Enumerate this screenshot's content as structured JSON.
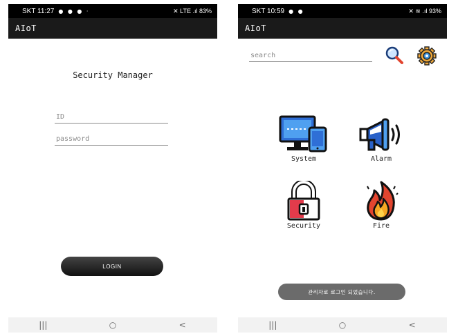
{
  "login_screen": {
    "status_bar": {
      "time": "SKT 11:27",
      "notifications": "● ● ● ·",
      "system": "✕ LTE .ıl 83%"
    },
    "app_title": "AIoT",
    "title": "Security Manager",
    "id_placeholder": "ID",
    "password_placeholder": "password",
    "login_label": "LOGIN",
    "nav": {
      "recent": "|||",
      "home": "○",
      "back": "<"
    }
  },
  "main_screen": {
    "status_bar": {
      "time": "SKT 10:59",
      "notifications": "● ●",
      "system": "✕ ≋ .ıl 93%"
    },
    "app_title": "AIoT",
    "search_placeholder": "search",
    "icons": {
      "search": "search-icon",
      "settings": "gear-icon"
    },
    "tiles": [
      {
        "label": "System",
        "icon": "monitor-phone-icon"
      },
      {
        "label": "Alarm",
        "icon": "megaphone-icon"
      },
      {
        "label": "Security",
        "icon": "padlock-icon"
      },
      {
        "label": "Fire",
        "icon": "fire-icon"
      }
    ],
    "toast": "관리자로 로그인 되었습니다.",
    "nav": {
      "recent": "|||",
      "home": "○",
      "back": "<"
    }
  },
  "colors": {
    "status_bar": "#000000",
    "app_bar": "#1a1a1a",
    "nav_bar": "#f2f2f2",
    "monitor_blue": "#2f6fd6",
    "alarm_blue": "#2a62c9",
    "lock_red": "#e23b4b",
    "fire_orange": "#f06a2a",
    "toast_gray": "#6b6b6b"
  }
}
